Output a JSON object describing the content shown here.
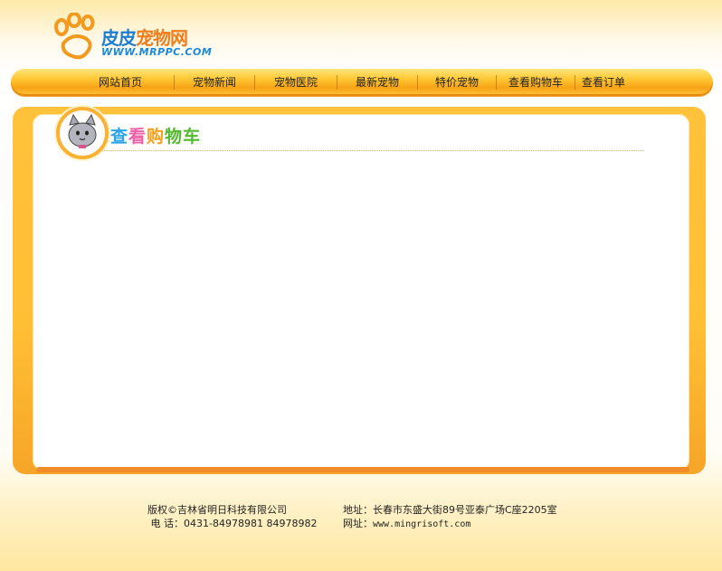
{
  "logo": {
    "title_part1": "皮皮",
    "title_part2": "宠物网",
    "url": "WWW.MRPPC.COM"
  },
  "nav": {
    "items": [
      {
        "label": "网站首页"
      },
      {
        "label": "宠物新闻"
      },
      {
        "label": "宠物医院"
      },
      {
        "label": "最新宠物"
      },
      {
        "label": "特价宠物"
      },
      {
        "label": "查看购物车"
      },
      {
        "label": "查看订单"
      }
    ]
  },
  "panel": {
    "title_chars": [
      "查",
      "看",
      "购",
      "物车"
    ],
    "badge_icon": "cat-face-icon"
  },
  "footer": {
    "copyright": "版权©吉林省明日科技有限公司",
    "phone_label": "电 话：",
    "phone_value": "0431-84978981 84978982",
    "address_label": "地址：",
    "address_value": "长春市东盛大街89号亚泰广场C座2205室",
    "website_label": "网址：",
    "website_value": "www.mingrisoft.com"
  },
  "colors": {
    "nav_gold": "#ffc531",
    "panel_orange": "#ffbf35",
    "logo_blue": "#1e7fd0",
    "logo_orange": "#f07d1a"
  }
}
